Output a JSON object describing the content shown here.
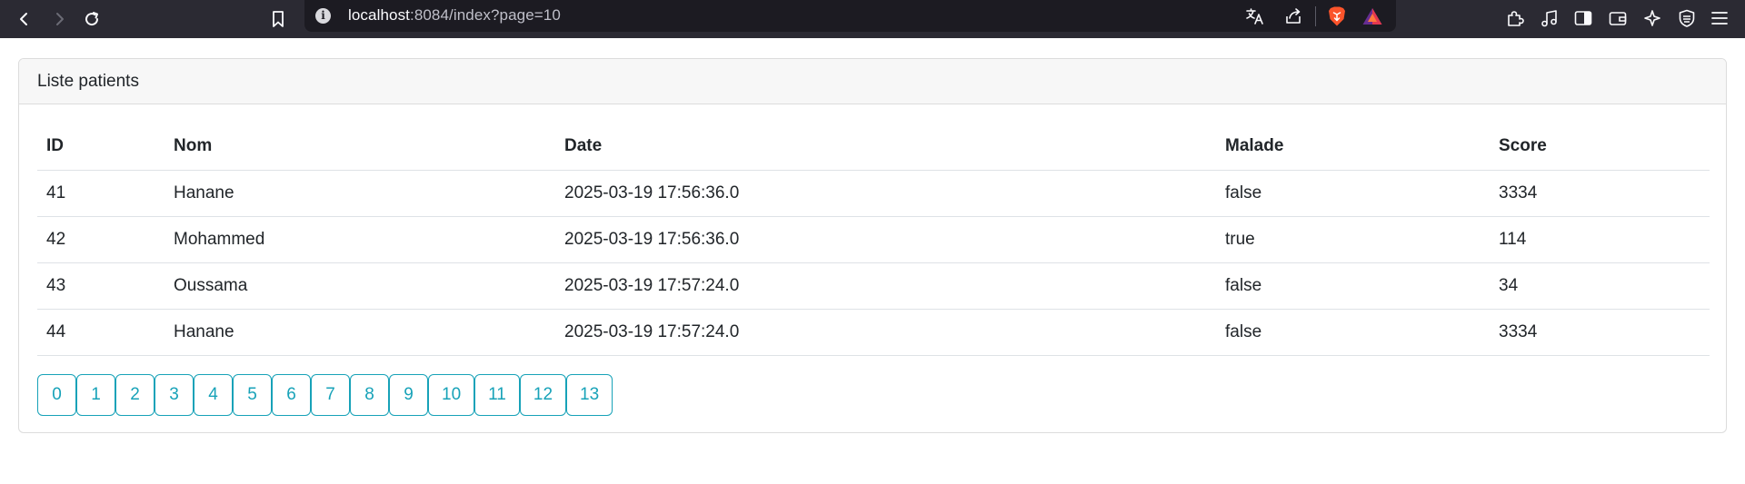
{
  "browser": {
    "url_host": "localhost",
    "url_rest": ":8084/index?page=10"
  },
  "card": {
    "title": "Liste patients"
  },
  "table": {
    "headers": [
      "ID",
      "Nom",
      "Date",
      "Malade",
      "Score"
    ],
    "rows": [
      [
        "41",
        "Hanane",
        "2025-03-19 17:56:36.0",
        "false",
        "3334"
      ],
      [
        "42",
        "Mohammed",
        "2025-03-19 17:56:36.0",
        "true",
        "114"
      ],
      [
        "43",
        "Oussama",
        "2025-03-19 17:57:24.0",
        "false",
        "34"
      ],
      [
        "44",
        "Hanane",
        "2025-03-19 17:57:24.0",
        "false",
        "3334"
      ]
    ]
  },
  "pagination": {
    "pages": [
      "0",
      "1",
      "2",
      "3",
      "4",
      "5",
      "6",
      "7",
      "8",
      "9",
      "10",
      "11",
      "12",
      "13"
    ],
    "accent_color": "#17a2b8"
  },
  "icons": {
    "nav": [
      "back-icon",
      "forward-icon",
      "reload-icon",
      "bookmark-icon"
    ],
    "url": [
      "site-info-icon",
      "translate-icon",
      "share-icon",
      "brave-shields-icon",
      "brave-rewards-icon"
    ],
    "toolbar": [
      "extensions-icon",
      "media-icon",
      "sidebar-icon",
      "wallet-icon",
      "leo-ai-icon",
      "vpn-icon",
      "menu-icon"
    ]
  }
}
